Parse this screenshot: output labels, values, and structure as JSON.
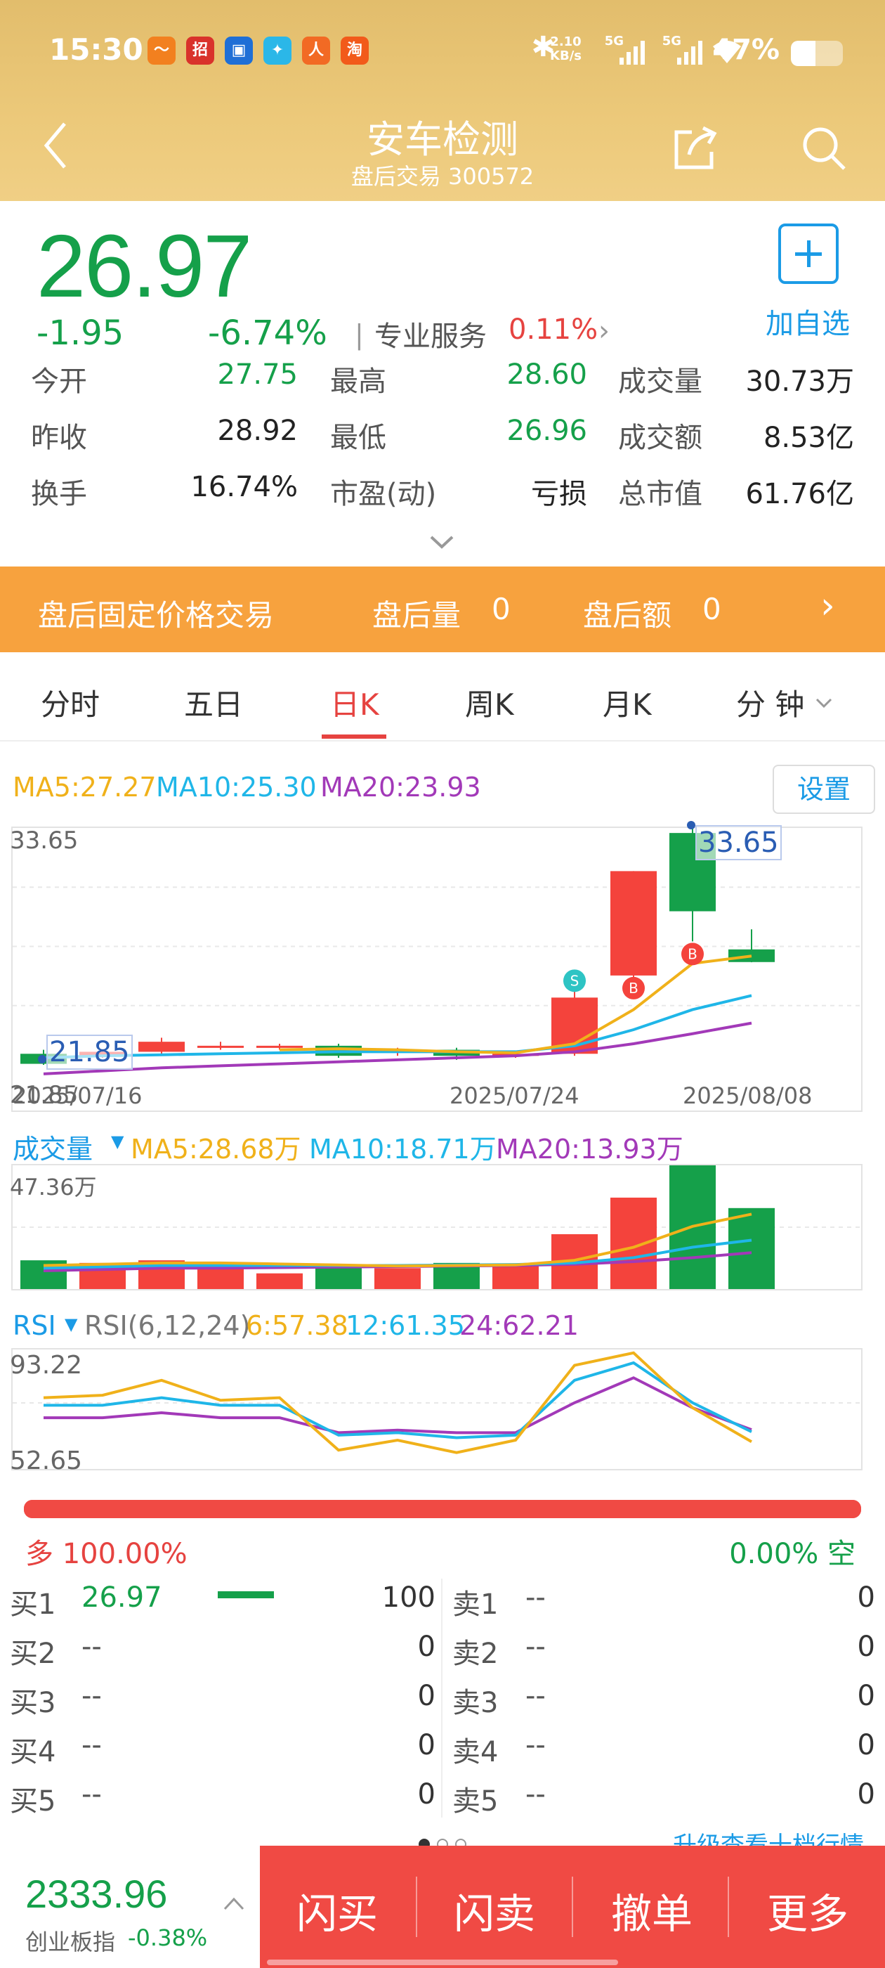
{
  "status_bar": {
    "time": "15:30",
    "app_icons": [
      {
        "name": "app-icon-1",
        "glyph": "〜",
        "color": "#f2801f"
      },
      {
        "name": "app-icon-2",
        "glyph": "招",
        "color": "#d9322b"
      },
      {
        "name": "app-icon-3",
        "glyph": "▣",
        "color": "#1f6fd6"
      },
      {
        "name": "app-icon-4",
        "glyph": "✦",
        "color": "#2bb7e8"
      },
      {
        "name": "app-icon-5",
        "glyph": "人",
        "color": "#f26a24"
      },
      {
        "name": "app-icon-6",
        "glyph": "淘",
        "color": "#f25a1a"
      }
    ],
    "speed_value": "2.10",
    "speed_unit": "KB/s",
    "sim1": "5G",
    "sim2": "5G",
    "battery": "47%",
    "battery_level": 0.47
  },
  "nav": {
    "title": "安车检测",
    "subtitle": "盘后交易 300572"
  },
  "quote": {
    "price": "26.97",
    "change": "-1.95",
    "change_pct": "-6.74%",
    "sector": "专业服务",
    "sector_pct": "0.11%",
    "watch_label": "加自选",
    "rows": [
      [
        {
          "label": "今开",
          "value": "27.75",
          "tone": "down"
        },
        {
          "label": "最高",
          "value": "28.60",
          "tone": "down"
        },
        {
          "label": "成交量",
          "value": "30.73万",
          "tone": "flat"
        }
      ],
      [
        {
          "label": "昨收",
          "value": "28.92",
          "tone": "flat"
        },
        {
          "label": "最低",
          "value": "26.96",
          "tone": "down"
        },
        {
          "label": "成交额",
          "value": "8.53亿",
          "tone": "flat"
        }
      ],
      [
        {
          "label": "换手",
          "value": "16.74%",
          "tone": "flat"
        },
        {
          "label": "市盈(动)",
          "value": "亏损",
          "tone": "flat"
        },
        {
          "label": "总市值",
          "value": "61.76亿",
          "tone": "flat"
        }
      ]
    ]
  },
  "afterhours": {
    "title": "盘后固定价格交易",
    "vol_label": "盘后量",
    "vol_value": "0",
    "amt_label": "盘后额",
    "amt_value": "0"
  },
  "tabs": [
    "分时",
    "五日",
    "日K",
    "周K",
    "月K",
    "分 钟"
  ],
  "active_tab": 2,
  "colors": {
    "up": "#f4433c",
    "down": "#15a04a",
    "ma5": "#f0b11a",
    "ma10": "#1fb6e8",
    "ma20": "#a239b8",
    "accent": "#1b9be6",
    "header": "#e9c476",
    "orange": "#f7a23e"
  },
  "kline": {
    "ma_legend": {
      "ma5": "MA5:27.27",
      "ma10": "MA10:25.30",
      "ma20": "MA20:23.93"
    },
    "settings": "设置",
    "y_top": "33.65",
    "y_bottom": "21.85",
    "max_tag": "33.65",
    "min_tag": "21.85",
    "dates": [
      "2025/07/16",
      "2025/07/24",
      "2025/08/08"
    ],
    "signals": {
      "s": "S",
      "b": "B"
    }
  },
  "volume": {
    "title": "成交量",
    "ma5": "MA5:28.68万",
    "ma10": "MA10:18.71万",
    "ma20": "MA20:13.93万",
    "y_top": "47.36万"
  },
  "rsi": {
    "title": "RSI",
    "params": "RSI(6,12,24)",
    "r6": "6:57.38",
    "r12": "12:61.35",
    "r24": "24:62.21",
    "y_top": "93.22",
    "y_bottom": "52.65"
  },
  "chart_data": {
    "type": "candlestick",
    "ylim": [
      21.85,
      33.65
    ],
    "dates": [
      "2025/07/16",
      "2025/07/24",
      "2025/08/08"
    ],
    "candles": [
      {
        "open": 22.4,
        "close": 21.9,
        "high": 22.6,
        "low": 21.85
      },
      {
        "open": 22.3,
        "close": 22.5,
        "high": 22.6,
        "low": 22.2
      },
      {
        "open": 22.5,
        "close": 23.0,
        "high": 23.2,
        "low": 22.4
      },
      {
        "open": 22.8,
        "close": 22.8,
        "high": 23.0,
        "low": 22.6
      },
      {
        "open": 22.7,
        "close": 22.8,
        "high": 22.9,
        "low": 22.6
      },
      {
        "open": 22.8,
        "close": 22.3,
        "high": 22.9,
        "low": 22.2
      },
      {
        "open": 22.5,
        "close": 22.6,
        "high": 22.7,
        "low": 22.3
      },
      {
        "open": 22.6,
        "close": 22.3,
        "high": 22.7,
        "low": 22.1
      },
      {
        "open": 22.3,
        "close": 22.4,
        "high": 22.5,
        "low": 22.2
      },
      {
        "open": 22.4,
        "close": 25.2,
        "high": 25.5,
        "low": 22.3
      },
      {
        "open": 26.3,
        "close": 31.5,
        "high": 31.5,
        "low": 25.5
      },
      {
        "open": 33.4,
        "close": 29.5,
        "high": 33.65,
        "low": 28.0
      },
      {
        "open": 27.6,
        "close": 26.97,
        "high": 28.6,
        "low": 26.96
      }
    ],
    "ma5": [
      null,
      null,
      null,
      null,
      22.6,
      22.65,
      22.6,
      22.5,
      22.45,
      22.9,
      24.6,
      26.9,
      27.27
    ],
    "ma10": [
      22.2,
      22.3,
      22.35,
      22.4,
      22.45,
      22.5,
      22.5,
      22.5,
      22.5,
      22.8,
      23.6,
      24.6,
      25.3
    ],
    "ma20": [
      21.4,
      21.55,
      21.7,
      21.8,
      21.9,
      22.0,
      22.1,
      22.2,
      22.3,
      22.5,
      22.9,
      23.4,
      23.93
    ],
    "volume": {
      "ylim_top": 47.36,
      "values": [
        11,
        10,
        11,
        10,
        6,
        9,
        8,
        10,
        9,
        21,
        35,
        47.36,
        31
      ],
      "ma5": [
        9,
        9.5,
        10,
        10,
        9.6,
        9.2,
        8.8,
        9,
        9.2,
        11,
        16,
        24,
        28.68
      ],
      "ma10": [
        8,
        8.5,
        9,
        9,
        9,
        9,
        9,
        9.2,
        9.4,
        10,
        12,
        16,
        18.71
      ],
      "ma20": [
        7,
        7.5,
        8,
        8,
        8.2,
        8.4,
        8.6,
        8.8,
        9,
        9.5,
        10.5,
        12,
        13.93
      ]
    },
    "rsi_ylim": [
      52.65,
      93.22
    ],
    "rsi6": [
      75,
      76,
      82,
      74,
      75,
      54,
      58,
      53,
      58,
      88,
      93,
      71,
      57.38
    ],
    "rsi12": [
      72,
      72,
      75,
      72,
      72,
      60,
      61,
      59,
      60,
      82,
      89,
      73,
      61.35
    ],
    "rsi24": [
      67,
      67,
      69,
      67,
      67,
      61,
      62,
      61,
      61,
      73,
      83,
      71,
      62.21
    ]
  },
  "long_short": {
    "long_label": "多",
    "long_pct": "100.00%",
    "short_label": "空",
    "short_pct": "0.00%",
    "long_ratio": 1.0
  },
  "orderbook": {
    "buy": [
      {
        "label": "买1",
        "price": "26.97",
        "vol": "100"
      },
      {
        "label": "买2",
        "price": "--",
        "vol": "0"
      },
      {
        "label": "买3",
        "price": "--",
        "vol": "0"
      },
      {
        "label": "买4",
        "price": "--",
        "vol": "0"
      },
      {
        "label": "买5",
        "price": "--",
        "vol": "0"
      }
    ],
    "sell": [
      {
        "label": "卖1",
        "price": "--",
        "vol": "0"
      },
      {
        "label": "卖2",
        "price": "--",
        "vol": "0"
      },
      {
        "label": "卖3",
        "price": "--",
        "vol": "0"
      },
      {
        "label": "卖4",
        "price": "--",
        "vol": "0"
      },
      {
        "label": "卖5",
        "price": "--",
        "vol": "0"
      }
    ],
    "upgrade": "升级查看十档行情"
  },
  "bottom": {
    "index_value": "2333.96",
    "index_name": "创业板指",
    "index_change": "-0.38%",
    "actions": [
      "闪买",
      "闪卖",
      "撤单",
      "更多"
    ]
  }
}
